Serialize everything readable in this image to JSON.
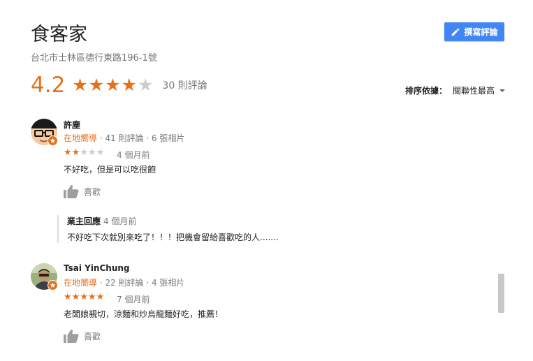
{
  "place": {
    "name": "食客家",
    "address": "台北市士林區德行東路196-1號",
    "rating": "4.2",
    "review_count": "30 則評論",
    "write_review_label": "撰寫評論"
  },
  "sort": {
    "label": "排序依據：",
    "value": "關聯性最高"
  },
  "colors": {
    "accent": "#e7711b",
    "button": "#4285f4",
    "muted": "#777777"
  },
  "reviews": [
    {
      "name": "許塵",
      "guide": "在地嚮導",
      "meta": " · 41 則評論 · 6 張相片",
      "stars": 2,
      "date": "4 個月前",
      "text": "不好吃，但是可以吃很飽",
      "like_label": "喜歡"
    },
    {
      "name": "Tsai YinChung",
      "guide": "在地嚮導",
      "meta": " · 22 則評論 · 4 張相片",
      "stars": 5,
      "date": "7 個月前",
      "text": "老闆娘親切，涼麵和炒烏龍麵好吃，推薦！",
      "like_label": "喜歡"
    }
  ],
  "owner_reply": {
    "label": "業主回應",
    "date": "4 個月前",
    "text": "不好吃下次就別來吃了！！！把機會留給喜歡吃的人......."
  }
}
